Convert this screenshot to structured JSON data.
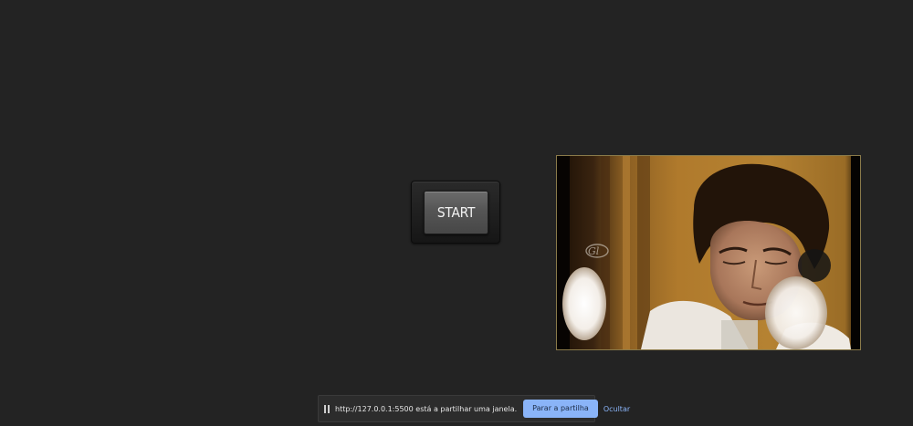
{
  "main": {
    "start_button_label": "START"
  },
  "share_bar": {
    "message": "http://127.0.0.1:5500 está a partilhar uma janela.",
    "stop_label": "Parar a partilha",
    "hide_label": "Ocultar",
    "pause_icon": "pause-icon"
  },
  "video": {
    "watermark_icon": "channel-logo-icon"
  },
  "colors": {
    "background": "#232323",
    "stop_button": "#8ab4f8",
    "link": "#8ab4f8",
    "video_border": "#8a7a4a"
  }
}
